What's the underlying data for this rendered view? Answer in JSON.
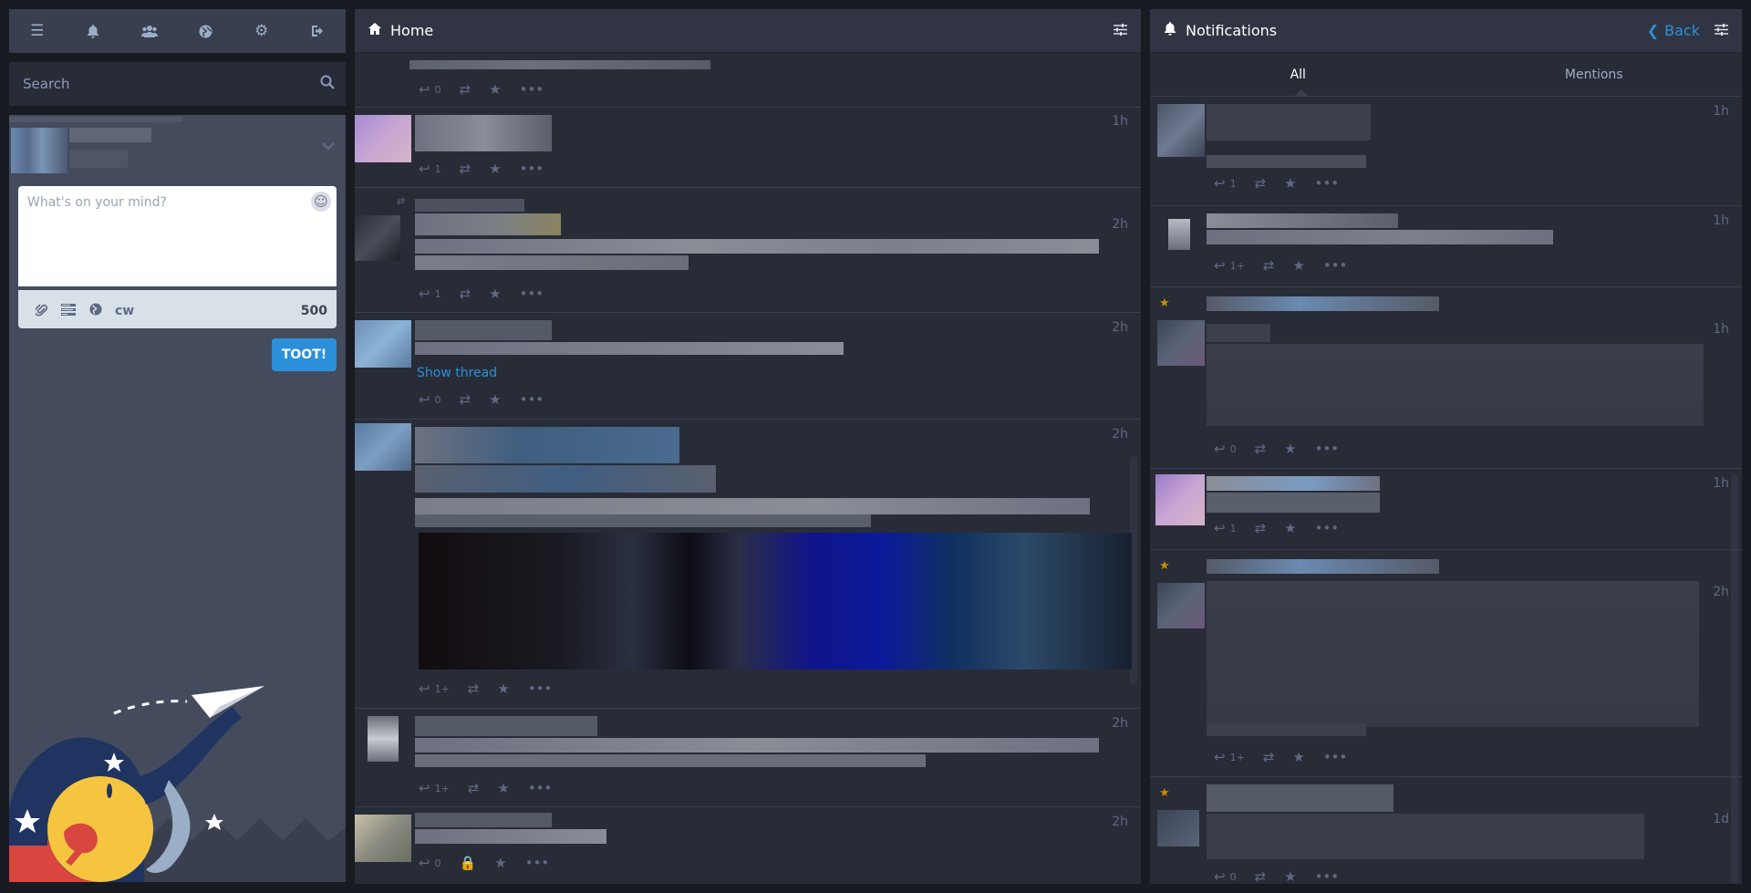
{
  "sidebar": {
    "tabs": [
      {
        "icon": "menu-icon",
        "glyph": "☰"
      },
      {
        "icon": "bell-icon",
        "glyph": "🔔"
      },
      {
        "icon": "users-icon",
        "glyph": "👥"
      },
      {
        "icon": "globe-icon",
        "glyph": "🌐"
      },
      {
        "icon": "gear-icon",
        "glyph": "⚙"
      },
      {
        "icon": "sign-out-icon",
        "glyph": "⏏"
      }
    ],
    "search": {
      "placeholder": "Search"
    },
    "composer": {
      "placeholder": "What's on your mind?",
      "char_count": "500",
      "cw_label": "cw",
      "submit_label": "TOOT!"
    }
  },
  "home": {
    "title": "Home",
    "show_thread": "Show thread",
    "statuses": [
      {
        "time": "",
        "replies": "0"
      },
      {
        "time": "1h",
        "replies": "1"
      },
      {
        "time": "2h",
        "replies": "1"
      },
      {
        "time": "2h",
        "replies": "0"
      },
      {
        "time": "2h",
        "replies": "1+"
      },
      {
        "time": "2h",
        "replies": "1+"
      },
      {
        "time": "2h",
        "replies": "0"
      }
    ]
  },
  "notifications": {
    "title": "Notifications",
    "back_label": "Back",
    "tabs": [
      "All",
      "Mentions"
    ],
    "items": [
      {
        "time": "1h",
        "replies": "1"
      },
      {
        "time": "1h",
        "replies": "1+"
      },
      {
        "time": "1h",
        "replies": "0"
      },
      {
        "time": "1h",
        "replies": "1"
      },
      {
        "time": "2h",
        "replies": "1+"
      },
      {
        "time": "1d",
        "replies": "0"
      }
    ]
  },
  "colors": {
    "accent": "#2b90d9",
    "favourite": "#ca8f04",
    "column_bg": "#282c37",
    "background": "#191b22"
  }
}
